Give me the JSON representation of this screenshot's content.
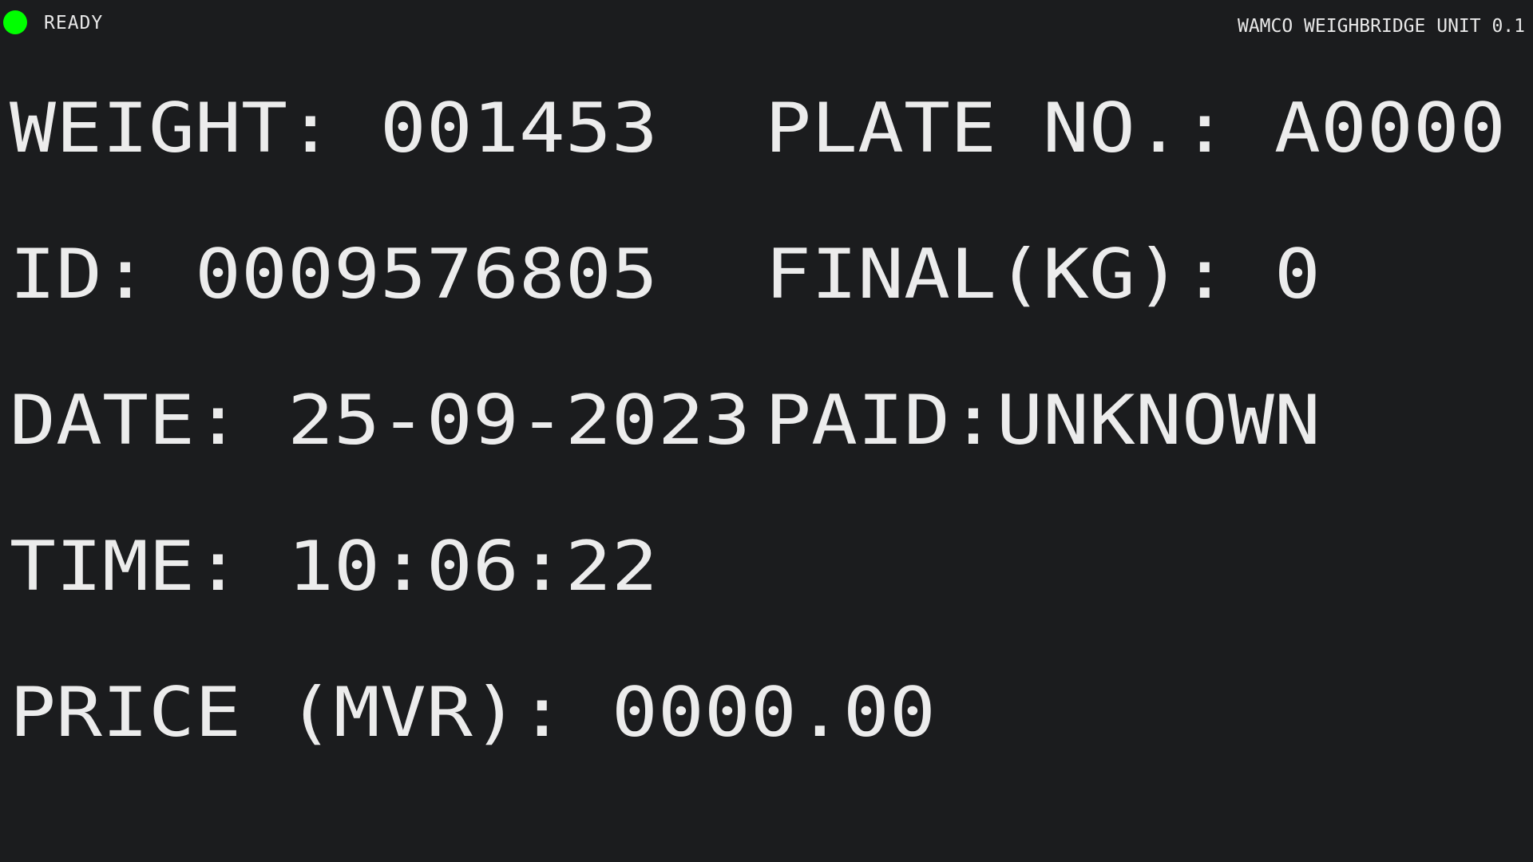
{
  "status": {
    "label": "READY",
    "color": "#00ff00"
  },
  "header": {
    "title": "WAMCO WEIGHBRIDGE UNIT 0.1"
  },
  "fields": {
    "weight": {
      "label": "WEIGHT:",
      "value": "001453"
    },
    "id": {
      "label": "ID:",
      "value": "0009576805"
    },
    "date": {
      "label": "DATE:",
      "value": "25-09-2023"
    },
    "time": {
      "label": "TIME:",
      "value": "10:06:22"
    },
    "price": {
      "label": "PRICE (MVR):",
      "value": "0000.00"
    },
    "plate": {
      "label": "PLATE NO.:",
      "value": "A0000"
    },
    "final": {
      "label": "FINAL(KG):",
      "value": "0"
    },
    "paid": {
      "label": "PAID:",
      "value": "UNKNOWN"
    }
  },
  "colors": {
    "background": "#1b1c1e",
    "text": "#e8e8e8",
    "status_ok": "#00ff00"
  }
}
